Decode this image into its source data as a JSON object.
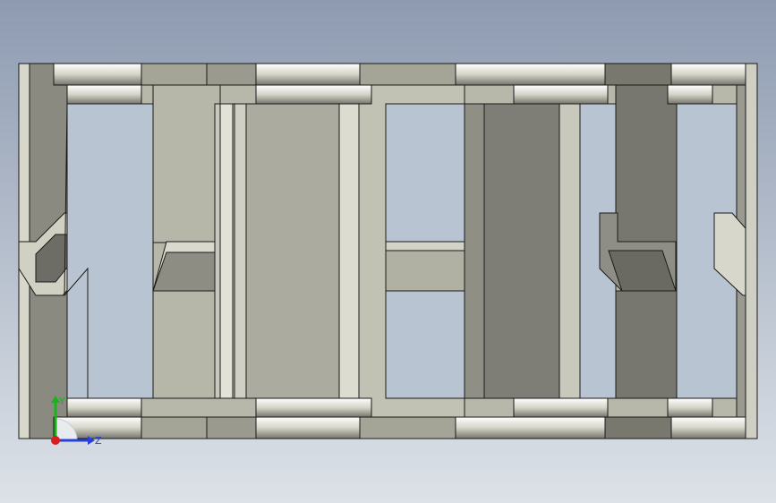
{
  "viewport": {
    "background_top": "#8e9bb1",
    "background_bottom": "#dde2e8"
  },
  "model": {
    "name": "drag-chain-link",
    "edge_color": "#1a1a1a"
  },
  "triad": {
    "y_label": "Y",
    "z_label": "Z",
    "y_color": "#19b419",
    "z_color": "#2a3fd8",
    "x_color": "#d81e1e"
  }
}
